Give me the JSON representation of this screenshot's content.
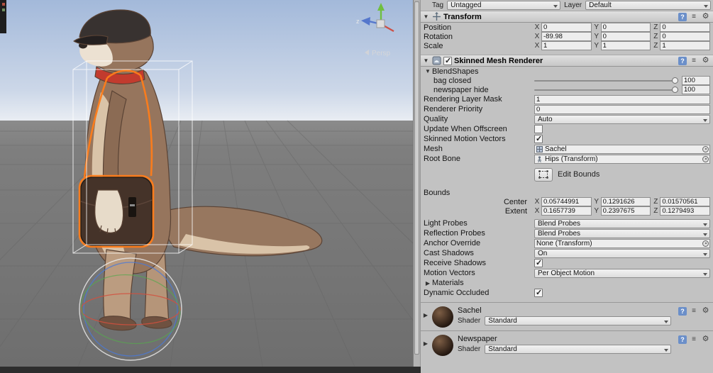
{
  "scene": {
    "persp_label": "Persp",
    "axis_label_z": "z"
  },
  "icons": {
    "fold_open": "▼",
    "fold_closed": "▶",
    "help": "?",
    "preset": "≡",
    "gear": "⚙"
  },
  "colors": {
    "selection_orange": "#ff7d1a",
    "inspector_bg": "#c2c2c2",
    "sky_top": "#a3b9da",
    "ground": "#7d7d7d"
  },
  "inspector": {
    "header": {
      "tag_label": "Tag",
      "tag_value": "Untagged",
      "layer_label": "Layer",
      "layer_value": "Default"
    },
    "axes": {
      "x": "X",
      "y": "Y",
      "z": "Z"
    },
    "transform": {
      "title": "Transform",
      "position": {
        "label": "Position",
        "x": "0",
        "y": "0",
        "z": "0"
      },
      "rotation": {
        "label": "Rotation",
        "x": "-89.98",
        "y": "0",
        "z": "0"
      },
      "scale": {
        "label": "Scale",
        "x": "1",
        "y": "1",
        "z": "1"
      }
    },
    "smr": {
      "title": "Skinned Mesh Renderer",
      "enabled": true,
      "blendshapes": {
        "label": "BlendShapes",
        "items": [
          {
            "label": "bag closed",
            "value": "100"
          },
          {
            "label": "newspaper hide",
            "value": "100"
          }
        ]
      },
      "rendering_layer_mask": {
        "label": "Rendering Layer Mask",
        "value": "1"
      },
      "renderer_priority": {
        "label": "Renderer Priority",
        "value": "0"
      },
      "quality": {
        "label": "Quality",
        "value": "Auto"
      },
      "update_when_offscreen": {
        "label": "Update When Offscreen",
        "checked": false
      },
      "skinned_motion_vectors": {
        "label": "Skinned Motion Vectors",
        "checked": true
      },
      "mesh": {
        "label": "Mesh",
        "value": "Sachel"
      },
      "root_bone": {
        "label": "Root Bone",
        "value": "Hips (Transform)"
      },
      "edit_bounds_label": "Edit Bounds",
      "bounds_label": "Bounds",
      "center": {
        "label": "Center",
        "x": "0.05744991",
        "y": "0.1291626",
        "z": "0.01570561"
      },
      "extent": {
        "label": "Extent",
        "x": "0.1657739",
        "y": "0.2397675",
        "z": "0.1279493"
      },
      "light_probes": {
        "label": "Light Probes",
        "value": "Blend Probes"
      },
      "reflection_probes": {
        "label": "Reflection Probes",
        "value": "Blend Probes"
      },
      "anchor_override": {
        "label": "Anchor Override",
        "value": "None (Transform)"
      },
      "cast_shadows": {
        "label": "Cast Shadows",
        "value": "On"
      },
      "receive_shadows": {
        "label": "Receive Shadows",
        "checked": true
      },
      "motion_vectors": {
        "label": "Motion Vectors",
        "value": "Per Object Motion"
      },
      "materials_label": "Materials",
      "dynamic_occluded": {
        "label": "Dynamic Occluded",
        "checked": true
      }
    },
    "materials": [
      {
        "name": "Sachel",
        "shader_label": "Shader",
        "shader": "Standard"
      },
      {
        "name": "Newspaper",
        "shader_label": "Shader",
        "shader": "Standard"
      }
    ]
  }
}
